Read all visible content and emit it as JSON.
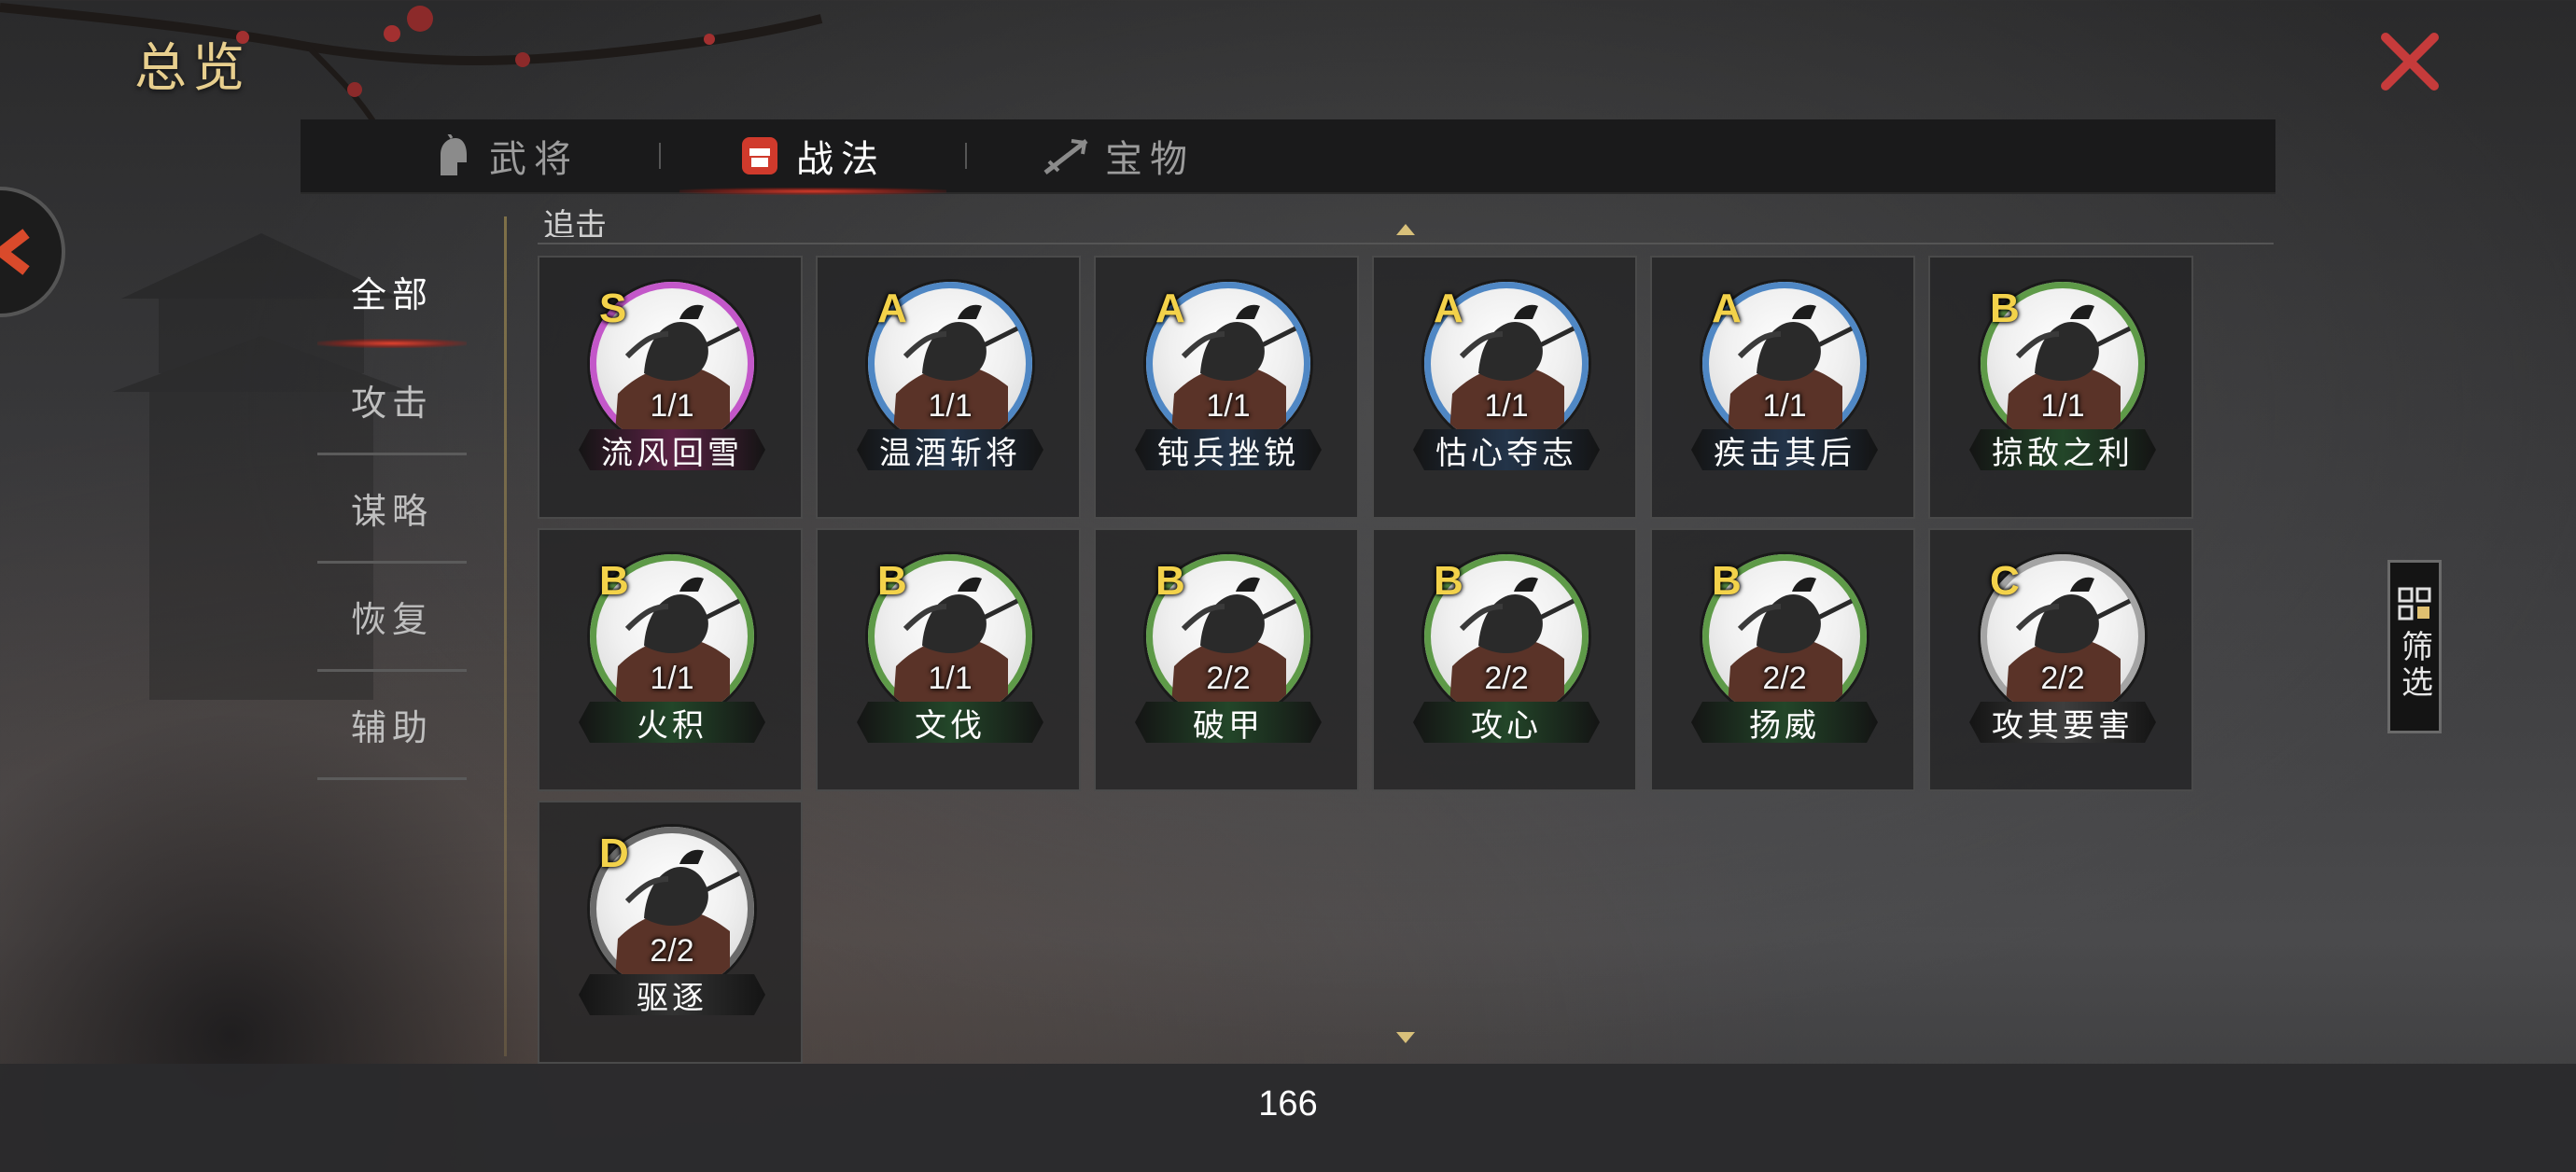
{
  "header": {
    "title": "总览",
    "close_icon": "close-x-icon",
    "accent_color": "#c63b3b"
  },
  "tabs": [
    {
      "label": "武将",
      "icon": "helmet-icon",
      "active": false
    },
    {
      "label": "战法",
      "icon": "fist-icon",
      "active": true
    },
    {
      "label": "宝物",
      "icon": "blade-icon",
      "active": false
    }
  ],
  "categories": [
    {
      "label": "全部",
      "active": true
    },
    {
      "label": "攻击",
      "active": false
    },
    {
      "label": "谋略",
      "active": false
    },
    {
      "label": "恢复",
      "active": false
    },
    {
      "label": "辅助",
      "active": false
    }
  ],
  "partial_label": "追击",
  "grade_colors": {
    "S": "#c357c9",
    "A": "#4f87c4",
    "B": "#5e9a48",
    "C": "#a4a4a4",
    "D": "#6a6a6a"
  },
  "plate_colors": {
    "S": "#5b2245",
    "A": "#233449",
    "B": "#234629",
    "C": "#3e3e3e",
    "D": "#333333"
  },
  "tactics": [
    {
      "grade": "S",
      "count": "1/1",
      "name": "流风回雪"
    },
    {
      "grade": "A",
      "count": "1/1",
      "name": "温酒斩将"
    },
    {
      "grade": "A",
      "count": "1/1",
      "name": "钝兵挫锐"
    },
    {
      "grade": "A",
      "count": "1/1",
      "name": "怙心夺志"
    },
    {
      "grade": "A",
      "count": "1/1",
      "name": "疾击其后"
    },
    {
      "grade": "B",
      "count": "1/1",
      "name": "掠敌之利"
    },
    {
      "grade": "B",
      "count": "1/1",
      "name": "火积"
    },
    {
      "grade": "B",
      "count": "1/1",
      "name": "文伐"
    },
    {
      "grade": "B",
      "count": "2/2",
      "name": "破甲"
    },
    {
      "grade": "B",
      "count": "2/2",
      "name": "攻心"
    },
    {
      "grade": "B",
      "count": "2/2",
      "name": "扬威"
    },
    {
      "grade": "C",
      "count": "2/2",
      "name": "攻其要害"
    },
    {
      "grade": "D",
      "count": "2/2",
      "name": "驱逐"
    }
  ],
  "filter": {
    "label": "筛选",
    "icon": "grid-filter-icon"
  },
  "footer": {
    "page_number": "166"
  }
}
